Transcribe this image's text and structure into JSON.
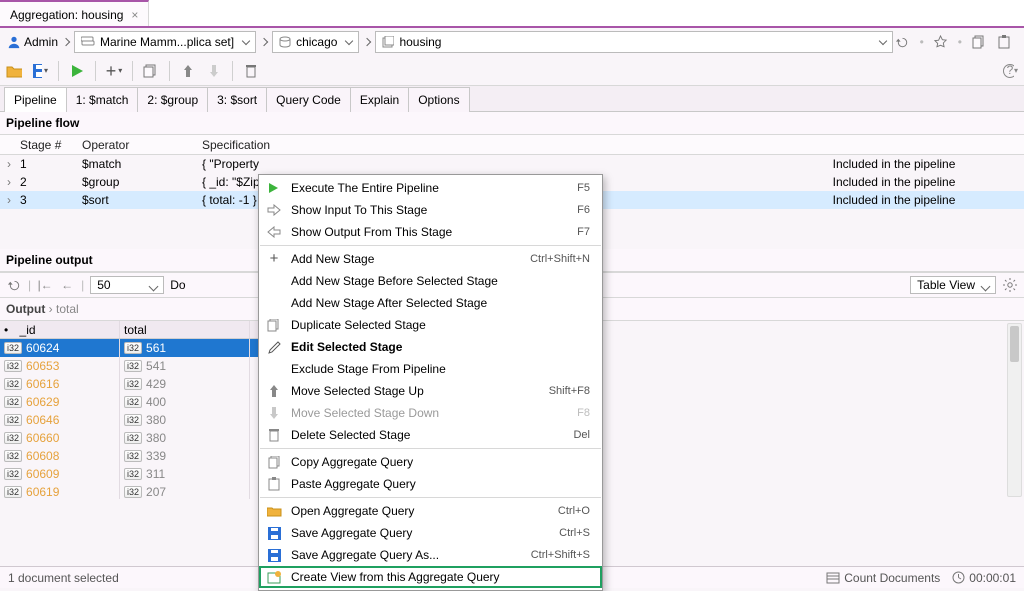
{
  "title_tab": {
    "label": "Aggregation: housing"
  },
  "breadcrumb": {
    "user": "Admin",
    "seg1": "Marine Mamm...plica set]",
    "seg2": "chicago",
    "seg3": "housing"
  },
  "tabs": {
    "pipeline": "Pipeline",
    "s1": "1: $match",
    "s2": "2: $group",
    "s3": "3: $sort",
    "query_code": "Query Code",
    "explain": "Explain",
    "options": "Options"
  },
  "pipeline_flow": {
    "header": "Pipeline flow",
    "col_stage": "Stage #",
    "col_operator": "Operator",
    "col_spec": "Specification",
    "rows": [
      {
        "n": "1",
        "op": "$match",
        "spec": "{ \"Property",
        "status": "Included in the pipeline"
      },
      {
        "n": "2",
        "op": "$group",
        "spec": "{ _id: \"$Zip",
        "status": "Included in the pipeline"
      },
      {
        "n": "3",
        "op": "$sort",
        "spec": "{ total: -1 }",
        "status": "Included in the pipeline"
      }
    ]
  },
  "pipeline_output": {
    "header": "Pipeline output",
    "pagesize": "50",
    "docs_prefix": "Do",
    "view_mode": "Table View",
    "breadcrumb_root": "Output",
    "breadcrumb_child": "total"
  },
  "grid": {
    "col_id": "_id",
    "col_total": "total",
    "tag": "i32",
    "bullet": "•",
    "rows": [
      {
        "id": "60624",
        "total": "561",
        "sel": true
      },
      {
        "id": "60653",
        "total": "541"
      },
      {
        "id": "60616",
        "total": "429"
      },
      {
        "id": "60629",
        "total": "400"
      },
      {
        "id": "60646",
        "total": "380"
      },
      {
        "id": "60660",
        "total": "380"
      },
      {
        "id": "60608",
        "total": "339"
      },
      {
        "id": "60609",
        "total": "311"
      },
      {
        "id": "60619",
        "total": "207"
      }
    ]
  },
  "context_menu": {
    "items": [
      {
        "icon": "play",
        "label": "Execute The Entire Pipeline",
        "shortcut": "F5"
      },
      {
        "icon": "arrow-in",
        "label": "Show Input To This Stage",
        "shortcut": "F6"
      },
      {
        "icon": "arrow-out",
        "label": "Show Output From This Stage",
        "shortcut": "F7"
      },
      {
        "sep": true
      },
      {
        "icon": "plus",
        "label": "Add New Stage",
        "shortcut": "Ctrl+Shift+N"
      },
      {
        "icon": "",
        "label": "Add New Stage Before Selected Stage"
      },
      {
        "icon": "",
        "label": "Add New Stage After Selected Stage"
      },
      {
        "icon": "dup",
        "label": "Duplicate Selected Stage"
      },
      {
        "icon": "edit",
        "label": "Edit Selected Stage",
        "bold": true
      },
      {
        "icon": "",
        "label": "Exclude Stage From Pipeline"
      },
      {
        "icon": "up",
        "label": "Move Selected Stage Up",
        "shortcut": "Shift+F8"
      },
      {
        "icon": "down",
        "label": "Move Selected Stage Down",
        "shortcut": "F8",
        "disabled": true
      },
      {
        "icon": "trash",
        "label": "Delete Selected Stage",
        "shortcut": "Del"
      },
      {
        "sep": true
      },
      {
        "icon": "copy",
        "label": "Copy Aggregate Query"
      },
      {
        "icon": "paste",
        "label": "Paste Aggregate Query"
      },
      {
        "sep": true
      },
      {
        "icon": "open",
        "label": "Open Aggregate Query",
        "shortcut": "Ctrl+O"
      },
      {
        "icon": "save",
        "label": "Save Aggregate Query",
        "shortcut": "Ctrl+S"
      },
      {
        "icon": "save",
        "label": "Save Aggregate Query As...",
        "shortcut": "Ctrl+Shift+S"
      },
      {
        "icon": "view",
        "label": "Create View from this Aggregate Query",
        "highlight": true
      }
    ]
  },
  "status": {
    "left": "1 document selected",
    "count_docs": "Count Documents",
    "elapsed": "00:00:01"
  }
}
